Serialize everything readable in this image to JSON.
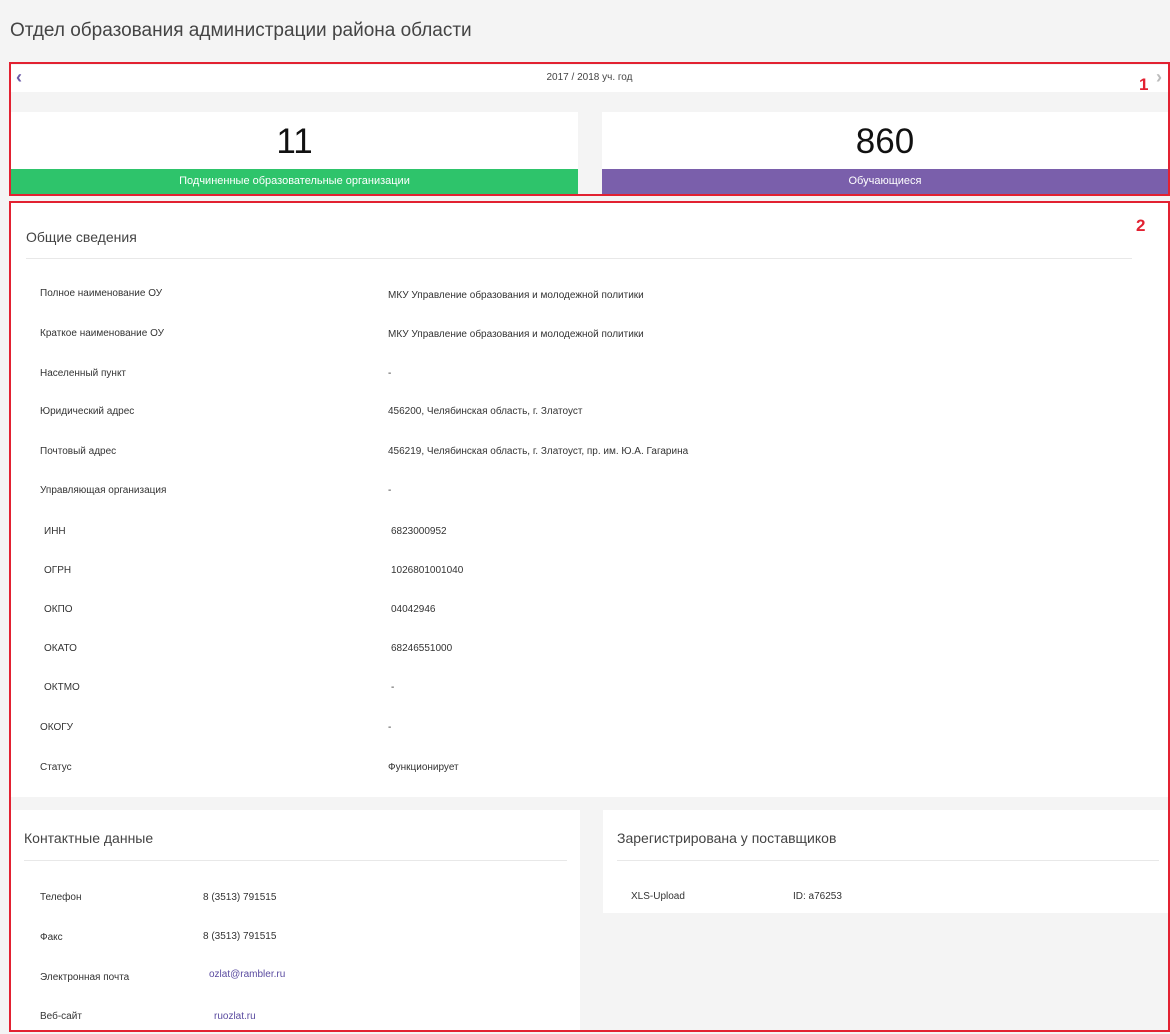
{
  "page": {
    "title": "Отдел образования администрации  района области"
  },
  "annotations": {
    "box1": "1",
    "box2": "2"
  },
  "year_nav": {
    "label": "2017 / 2018  уч. год",
    "prev_icon": "chevron-left-icon",
    "next_icon": "chevron-right-icon"
  },
  "stats": [
    {
      "value": "11",
      "label": "Подчиненные образовательные организации",
      "color": "#2ec46b"
    },
    {
      "value": "860",
      "label": "Обучающиеся",
      "color": "#7a5fab"
    }
  ],
  "general": {
    "title": "Общие сведения",
    "rows": [
      {
        "label": "Полное наименование ОУ",
        "value": "МКУ Управление образования и молодежной политики"
      },
      {
        "label": "Краткое наименование ОУ",
        "value": "МКУ Управление образования и молодежной политики"
      },
      {
        "label": "Населенный пункт",
        "value": "-"
      },
      {
        "label": "Юридический адрес",
        "value": "456200, Челябинская область, г. Златоуст"
      },
      {
        "label": "Почтовый адрес",
        "value": "456219, Челябинская область, г. Златоуст, пр. им. Ю.А. Гагарина"
      },
      {
        "label": "Управляющая организация",
        "value": "-"
      },
      {
        "label": "ИНН",
        "value": "6823000952"
      },
      {
        "label": "ОГРН",
        "value": "1026801001040"
      },
      {
        "label": "ОКПО",
        "value": "04042946"
      },
      {
        "label": "ОКАТО",
        "value": "68246551000"
      },
      {
        "label": "ОКТМО",
        "value": "-"
      },
      {
        "label": "ОКОГУ",
        "value": "-"
      },
      {
        "label": "Статус",
        "value": "Функционирует"
      }
    ]
  },
  "contacts": {
    "title": "Контактные данные",
    "rows": [
      {
        "label": "Телефон",
        "value": "8 (3513) 791515"
      },
      {
        "label": "Факс",
        "value": "8 (3513) 791515"
      },
      {
        "label": "Электронная почта",
        "value": "ozlat@rambler.ru"
      },
      {
        "label": "Веб-сайт",
        "value": "ruozlat.ru"
      }
    ]
  },
  "providers": {
    "title": "Зарегистрирована у поставщиков",
    "rows": [
      {
        "label": "XLS-Upload",
        "value": "ID: a76253"
      }
    ]
  },
  "colors": {
    "accent": "#6b5aa8",
    "annotation": "#e22131"
  }
}
